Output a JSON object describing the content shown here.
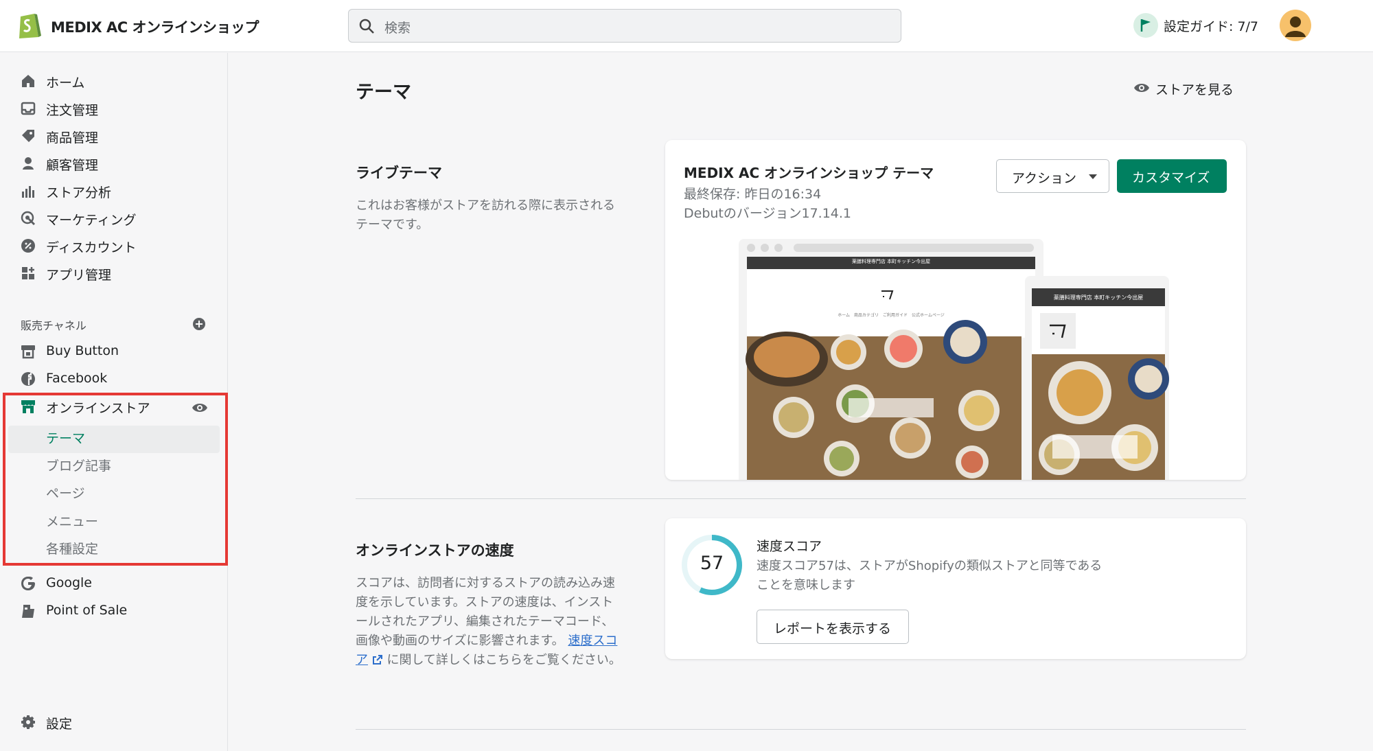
{
  "header": {
    "shop_name": "MEDIX AC オンラインショップ",
    "search_placeholder": "検索",
    "setup_guide": "設定ガイド: 7/7"
  },
  "sidebar": {
    "items": [
      {
        "label": "ホーム",
        "icon": "home-icon"
      },
      {
        "label": "注文管理",
        "icon": "inbox-icon"
      },
      {
        "label": "商品管理",
        "icon": "tag-icon"
      },
      {
        "label": "顧客管理",
        "icon": "person-icon"
      },
      {
        "label": "ストア分析",
        "icon": "bar-chart-icon"
      },
      {
        "label": "マーケティング",
        "icon": "target-icon"
      },
      {
        "label": "ディスカウント",
        "icon": "discount-icon"
      },
      {
        "label": "アプリ管理",
        "icon": "apps-icon"
      }
    ],
    "channels_title": "販売チャネル",
    "channels": [
      {
        "label": "Buy Button",
        "icon": "buy-button-icon"
      },
      {
        "label": "Facebook",
        "icon": "facebook-icon"
      },
      {
        "label": "オンラインストア",
        "icon": "store-icon"
      }
    ],
    "online_store_sub": [
      "テーマ",
      "ブログ記事",
      "ページ",
      "メニュー",
      "各種設定"
    ],
    "other_channels": [
      {
        "label": "Google",
        "icon": "google-icon"
      },
      {
        "label": "Point of Sale",
        "icon": "pos-icon"
      }
    ],
    "settings": "設定",
    "highlight_color": "#e53935"
  },
  "main": {
    "title": "テーマ",
    "view_store": "ストアを見る",
    "live_theme": {
      "heading": "ライブテーマ",
      "description": "これはお客様がストアを訪れる際に表示されるテーマです。",
      "theme_name": "MEDIX AC オンラインショップ テーマ",
      "last_saved": "最終保存: 昨日の16:34",
      "version": "Debutのバージョン17.14.1",
      "action_button": "アクション",
      "customize_button": "カスタマイズ",
      "preview_banner": "薬膳料理専門店 本町キッチン今出屋",
      "preview_nav": "ホーム　商品カテゴリ　ご利用ガイド　公式ホームページ",
      "preview_mobile_banner": "薬膳料理専門店 本町キッチン今出屋"
    },
    "speed": {
      "heading": "オンラインストアの速度",
      "description": "スコアは、訪問者に対するストアの読み込み速度を示しています。ストアの速度は、インストールされたアプリ、編集されたテーマコード、画像や動画のサイズに影響されます。",
      "link_text": "速度スコア",
      "link_suffix": "に関して詳しくはこちらをご覧ください。",
      "score_title": "速度スコア",
      "score": 57,
      "score_text": "57",
      "score_desc": "速度スコア57は、ストアがShopifyの類似ストアと同等であることを意味します",
      "report_button": "レポートを表示する"
    },
    "accent_color": "#008060"
  }
}
